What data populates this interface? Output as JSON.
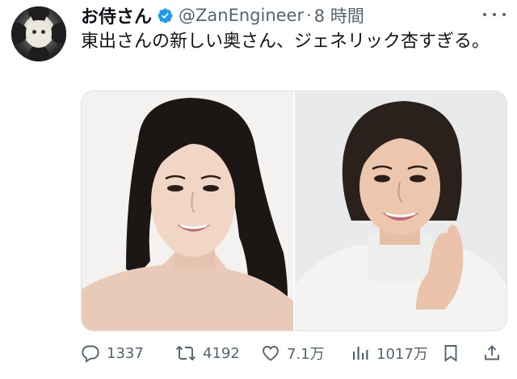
{
  "user": {
    "display_name": "お侍さん",
    "handle": "@ZanEngineer",
    "separator": "·",
    "time": "8 時間",
    "verified": true
  },
  "tweet": {
    "text": "東出さんの新しい奥さん、ジェネリック杏すぎる。"
  },
  "media": {
    "count": 2
  },
  "actions": {
    "reply_count": "1337",
    "retweet_count": "4192",
    "like_count": "7.1万",
    "view_count": "1017万"
  },
  "colors": {
    "verified_blue": "#1d9bf0",
    "muted_text": "#536471",
    "primary_text": "#0f1419"
  },
  "icons": {
    "avatar": "cat-avatar",
    "verified": "verified-badge-icon",
    "more": "more-dots-icon",
    "reply": "reply-icon",
    "retweet": "retweet-icon",
    "like": "heart-icon",
    "views": "views-bar-icon",
    "bookmark": "bookmark-icon",
    "share": "share-icon"
  }
}
